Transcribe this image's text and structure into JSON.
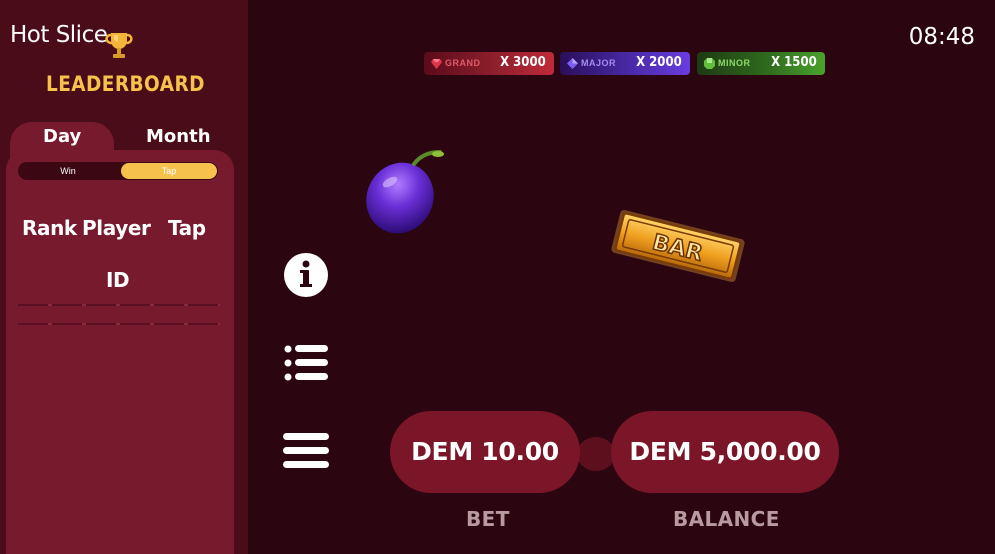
{
  "app": {
    "title": "Hot Slice",
    "clock": "08:48"
  },
  "leaderboard": {
    "title": "LEADERBOARD",
    "tabs": [
      "Day",
      "Month"
    ],
    "toggle": [
      "Win",
      "Tap"
    ],
    "columns": {
      "rank": "Rank",
      "player": "Player",
      "player_sub": "ID",
      "tap": "Tap"
    }
  },
  "jackpots": [
    {
      "label": "GRAND",
      "value": "X 3000",
      "color": "#c02a38"
    },
    {
      "label": "MAJOR",
      "value": "X 2000",
      "color": "#6a3ce0"
    },
    {
      "label": "MINOR",
      "value": "X 1500",
      "color": "#4aa22c"
    }
  ],
  "game": {
    "symbols": [
      "plum-icon",
      "bar-icon"
    ],
    "bar_text": "BAR"
  },
  "controls": {
    "bet_value": "DEM 10.00",
    "bet_label": "BET",
    "balance_value": "DEM 5,000.00",
    "balance_label": "BALANCE"
  },
  "colors": {
    "background": "#2b0611",
    "sidebar": "#4a0c19",
    "panel": "#771a2d",
    "accent_gold": "#f6c24b",
    "pill": "#7a1627"
  }
}
